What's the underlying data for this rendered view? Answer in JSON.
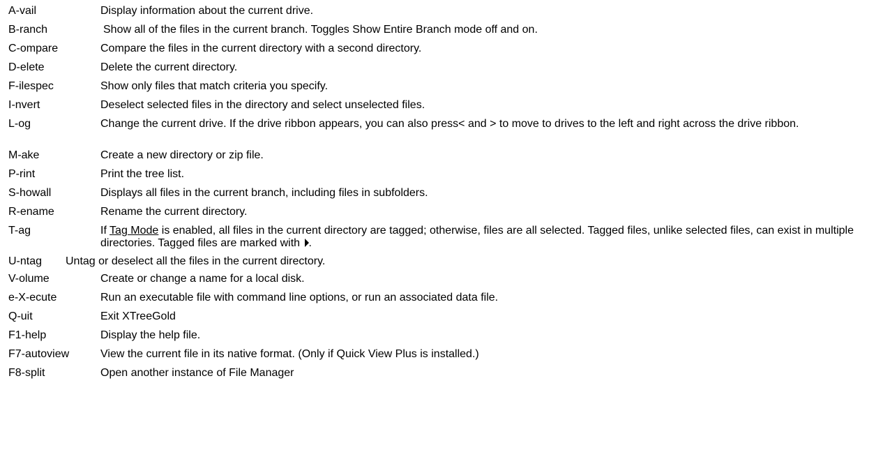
{
  "commands": [
    {
      "key": "A-vail",
      "desc": "Display information about the current drive."
    },
    {
      "key": "B-ranch",
      "desc": "Show all of the files in the current branch. Toggles Show Entire Branch mode off and on."
    },
    {
      "key": "C-ompare",
      "desc": "Compare the files in the current directory with a second directory."
    },
    {
      "key": "D-elete",
      "desc": "Delete the current directory."
    },
    {
      "key": "F-ilespec",
      "desc": "Show only files that match criteria you specify."
    },
    {
      "key": "I-nvert",
      "desc": "Deselect selected files in the directory and select unselected files."
    },
    {
      "key": "L-og",
      "desc": "Change the current drive. If the drive ribbon appears, you can also press< and > to move to drives to the left and right across the drive ribbon."
    },
    {
      "key": "M-ake",
      "desc": "Create a new directory or zip file."
    },
    {
      "key": "P-rint",
      "desc": "Print the tree list."
    },
    {
      "key": "S-howall",
      "desc": "Displays all files in the current branch, including files in subfolders."
    },
    {
      "key": "R-ename",
      "desc": "Rename the current directory."
    },
    {
      "key": "T-ag",
      "desc_before": "If ",
      "link": "Tag Mode",
      "desc_after": " is enabled, all files in the current directory are tagged; otherwise, files are all selected. Tagged files, unlike selected files, can exist in multiple directories. Tagged files are marked with ",
      "desc_end": "."
    },
    {
      "key": "U-ntag",
      "desc": "Untag or deselect all the files in the current directory."
    },
    {
      "key": "V-olume",
      "desc": "Create or change a name for a local disk."
    },
    {
      "key": "e-X-ecute",
      "desc": "Run an executable file with command line options, or run an associated data file."
    },
    {
      "key": "Q-uit",
      "desc": "Exit XTreeGold"
    },
    {
      "key": "F1-help",
      "desc": "Display the help file."
    },
    {
      "key": "F7-autoview",
      "desc": "View the current file in its native format. (Only if Quick View Plus is installed.)"
    },
    {
      "key": "F8-split",
      "desc": "Open another instance of File Manager"
    }
  ]
}
